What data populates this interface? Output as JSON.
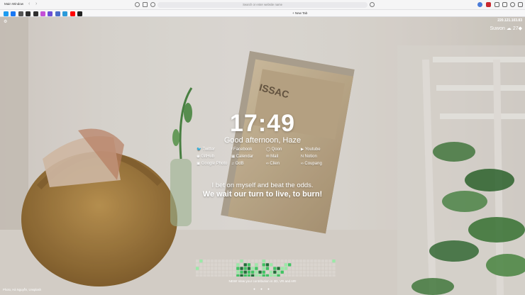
{
  "browser": {
    "window_label": "Main Window",
    "address_placeholder": "Search or enter website name",
    "new_tab_label": "New Tab"
  },
  "bookmarks": [
    {
      "name": "twitter-bookmark",
      "color": "#1d9bf0"
    },
    {
      "name": "facebook-bookmark",
      "color": "#1877f2"
    },
    {
      "name": "bookmark-3",
      "color": "#555555"
    },
    {
      "name": "bookmark-4",
      "color": "#2f2f2f"
    },
    {
      "name": "bookmark-5",
      "color": "#2f2f2f"
    },
    {
      "name": "bookmark-6",
      "color": "#c44fd6"
    },
    {
      "name": "bookmark-7",
      "color": "#6b4fd6"
    },
    {
      "name": "bookmark-8",
      "color": "#4b6cc7"
    },
    {
      "name": "bookmark-9",
      "color": "#2a9ad9"
    },
    {
      "name": "youtube-bookmark",
      "color": "#ff0000"
    },
    {
      "name": "github-bookmark",
      "color": "#222222"
    }
  ],
  "header": {
    "ip": "220.121.103.83",
    "city": "Suwon",
    "temp": "27"
  },
  "clock": {
    "time": "17:49",
    "greeting": "Good afternoon, Haze"
  },
  "links": [
    {
      "label": "Twitter",
      "icon": "bird-icon",
      "col": 0,
      "row": 0
    },
    {
      "label": "Facebook",
      "icon": "facebook-icon",
      "col": 1,
      "row": 0
    },
    {
      "label": "Qoon",
      "icon": "chat-icon",
      "col": 2,
      "row": 0
    },
    {
      "label": "Youtube",
      "icon": "youtube-icon",
      "col": 3,
      "row": 0
    },
    {
      "label": "GitHub",
      "icon": "github-icon",
      "col": 0,
      "row": 1
    },
    {
      "label": "Calendar",
      "icon": "calendar-icon",
      "col": 1,
      "row": 1
    },
    {
      "label": "Mail",
      "icon": "mail-icon",
      "col": 2,
      "row": 1
    },
    {
      "label": "Notion",
      "icon": "notion-icon",
      "col": 3,
      "row": 1
    },
    {
      "label": "Google Photo",
      "icon": "photo-icon",
      "col": 0,
      "row": 2
    },
    {
      "label": "OdB",
      "icon": "music-icon",
      "col": 1,
      "row": 2
    },
    {
      "label": "Clien",
      "icon": "link-icon",
      "col": 2,
      "row": 2
    },
    {
      "label": "Coupang",
      "icon": "link-icon",
      "col": 3,
      "row": 2
    }
  ],
  "quote": {
    "line1": "I bet on myself and beat the odds.",
    "line2": "We wait our turn to live, to burn!"
  },
  "contributions": {
    "text": "NEW! View your contribution in 3D, VR and AR!",
    "levels": [
      0,
      1,
      0,
      0,
      0,
      0,
      0,
      0,
      0,
      0,
      0,
      0,
      1,
      0,
      0,
      0,
      0,
      0,
      1,
      0,
      0,
      0,
      0,
      0,
      0,
      0,
      0,
      0,
      0,
      0,
      0,
      0,
      0,
      0,
      0,
      0,
      0,
      1,
      0,
      0,
      0,
      0,
      0,
      0,
      0,
      0,
      0,
      0,
      0,
      1,
      0,
      3,
      2,
      0,
      1,
      0,
      2,
      3,
      1,
      0,
      0,
      0,
      1,
      2,
      0,
      0,
      0,
      0,
      0,
      0,
      0,
      0,
      0,
      0,
      0,
      0,
      1,
      0,
      0,
      0,
      0,
      0,
      0,
      0,
      0,
      0,
      0,
      2,
      3,
      2,
      3,
      1,
      2,
      0,
      1,
      2,
      0,
      2,
      3,
      1,
      1,
      0,
      0,
      0,
      0,
      0,
      0,
      0,
      0,
      0,
      0,
      0,
      0,
      0,
      0,
      0,
      0,
      0,
      0,
      0,
      0,
      0,
      0,
      0,
      0,
      1,
      2,
      3,
      2,
      2,
      1,
      3,
      2,
      0,
      1,
      3,
      1,
      2,
      0,
      0,
      0,
      0,
      0,
      0,
      0,
      0,
      0,
      0,
      0,
      0,
      0,
      0,
      0,
      0,
      0,
      0,
      0,
      0,
      0,
      0,
      0,
      0,
      0,
      2,
      3,
      2,
      2,
      3,
      1,
      1,
      2,
      2,
      1,
      1,
      2,
      0,
      0,
      0,
      0,
      0,
      0,
      0,
      0,
      0,
      0,
      0,
      0,
      0,
      0,
      0
    ]
  },
  "carousel_dots": "● ● ●",
  "photo_credit": "Photo, Hà Nguyễn, Unsplash"
}
